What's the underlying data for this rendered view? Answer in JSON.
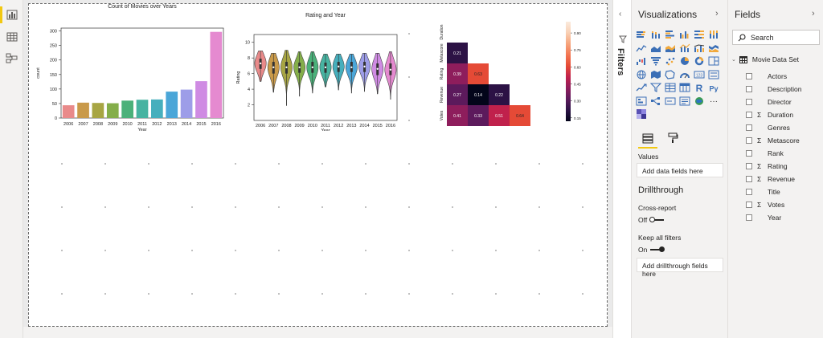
{
  "left_nav": {
    "items": [
      "report-view-icon",
      "data-view-icon",
      "model-view-icon"
    ]
  },
  "visualizations": {
    "title": "Visualizations",
    "more_label": "···",
    "values_label": "Values",
    "values_placeholder": "Add data fields here",
    "drillthrough_title": "Drillthrough",
    "cross_report_label": "Cross-report",
    "cross_report_state": "Off",
    "keep_filters_label": "Keep all filters",
    "keep_filters_state": "On",
    "drillthrough_placeholder": "Add drillthrough fields here",
    "r_label": "R",
    "py_label": "Py"
  },
  "filters": {
    "label": "Filters"
  },
  "fields": {
    "title": "Fields",
    "search_placeholder": "Search",
    "table_name": "Movie Data Set",
    "items": [
      {
        "name": "Actors",
        "sigma": ""
      },
      {
        "name": "Description",
        "sigma": ""
      },
      {
        "name": "Director",
        "sigma": ""
      },
      {
        "name": "Duration",
        "sigma": "Σ"
      },
      {
        "name": "Genres",
        "sigma": ""
      },
      {
        "name": "Metascore",
        "sigma": "Σ"
      },
      {
        "name": "Rank",
        "sigma": ""
      },
      {
        "name": "Rating",
        "sigma": "Σ"
      },
      {
        "name": "Revenue",
        "sigma": "Σ"
      },
      {
        "name": "Title",
        "sigma": ""
      },
      {
        "name": "Votes",
        "sigma": "Σ"
      },
      {
        "name": "Year",
        "sigma": ""
      }
    ]
  },
  "chart_data": [
    {
      "type": "bar",
      "title": "Count of Movies over Years",
      "xlabel": "Year",
      "ylabel": "count",
      "categories": [
        "2006",
        "2007",
        "2008",
        "2009",
        "2010",
        "2011",
        "2012",
        "2013",
        "2014",
        "2015",
        "2016"
      ],
      "values": [
        44,
        53,
        52,
        51,
        60,
        63,
        64,
        91,
        98,
        127,
        297
      ],
      "ylim": [
        0,
        310
      ],
      "yticks": [
        0,
        50,
        100,
        150,
        200,
        250,
        300
      ],
      "colors": [
        "#e98a8a",
        "#c99a4a",
        "#a7a543",
        "#84ae4a",
        "#4bb17a",
        "#47b3a1",
        "#46afbd",
        "#4aa6d8",
        "#9d9de8",
        "#cf8be3",
        "#e58ad0"
      ]
    },
    {
      "type": "violin",
      "title": "Rating and Year",
      "xlabel": "Year",
      "ylabel": "Rating",
      "categories": [
        "2006",
        "2007",
        "2008",
        "2009",
        "2010",
        "2011",
        "2012",
        "2013",
        "2014",
        "2015",
        "2016"
      ],
      "ylim": [
        0,
        11
      ],
      "yticks": [
        2,
        4,
        6,
        8,
        10
      ],
      "series": [
        {
          "min": 5.0,
          "q1": 6.6,
          "median": 7.3,
          "q3": 7.9,
          "max": 8.9
        },
        {
          "min": 3.6,
          "q1": 6.0,
          "median": 6.8,
          "q3": 7.5,
          "max": 8.6
        },
        {
          "min": 1.9,
          "q1": 6.0,
          "median": 6.8,
          "q3": 7.5,
          "max": 9.0
        },
        {
          "min": 3.1,
          "q1": 6.1,
          "median": 6.8,
          "q3": 7.4,
          "max": 8.8
        },
        {
          "min": 3.5,
          "q1": 6.1,
          "median": 6.8,
          "q3": 7.5,
          "max": 8.8
        },
        {
          "min": 4.3,
          "q1": 6.1,
          "median": 6.8,
          "q3": 7.4,
          "max": 8.5
        },
        {
          "min": 3.9,
          "q1": 6.2,
          "median": 6.9,
          "q3": 7.5,
          "max": 8.5
        },
        {
          "min": 3.5,
          "q1": 6.2,
          "median": 6.8,
          "q3": 7.5,
          "max": 8.5
        },
        {
          "min": 3.7,
          "q1": 6.2,
          "median": 6.9,
          "q3": 7.5,
          "max": 8.6
        },
        {
          "min": 3.4,
          "q1": 5.8,
          "median": 6.6,
          "q3": 7.3,
          "max": 8.6
        },
        {
          "min": 2.7,
          "q1": 5.8,
          "median": 6.5,
          "q3": 7.3,
          "max": 8.8
        }
      ],
      "colors": [
        "#e98a8a",
        "#c99a4a",
        "#a7a543",
        "#84ae4a",
        "#4bb17a",
        "#47b3a1",
        "#46afbd",
        "#4aa6d8",
        "#9d9de8",
        "#cf8be3",
        "#e58ad0"
      ]
    },
    {
      "type": "heatmap",
      "labels": [
        "Duration",
        "Metascore",
        "Rating",
        "Revenue",
        "Votes"
      ],
      "cells": [
        {
          "row": 1,
          "col": 0,
          "value": 0.21
        },
        {
          "row": 2,
          "col": 0,
          "value": 0.39
        },
        {
          "row": 2,
          "col": 1,
          "value": 0.63
        },
        {
          "row": 3,
          "col": 0,
          "value": 0.27
        },
        {
          "row": 3,
          "col": 1,
          "value": 0.14
        },
        {
          "row": 3,
          "col": 2,
          "value": 0.22
        },
        {
          "row": 4,
          "col": 0,
          "value": 0.41
        },
        {
          "row": 4,
          "col": 1,
          "value": 0.33
        },
        {
          "row": 4,
          "col": 2,
          "value": 0.51
        },
        {
          "row": 4,
          "col": 3,
          "value": 0.64
        }
      ],
      "colorbar_ticks": [
        0.15,
        0.3,
        0.45,
        0.6,
        0.75,
        0.9
      ]
    }
  ]
}
